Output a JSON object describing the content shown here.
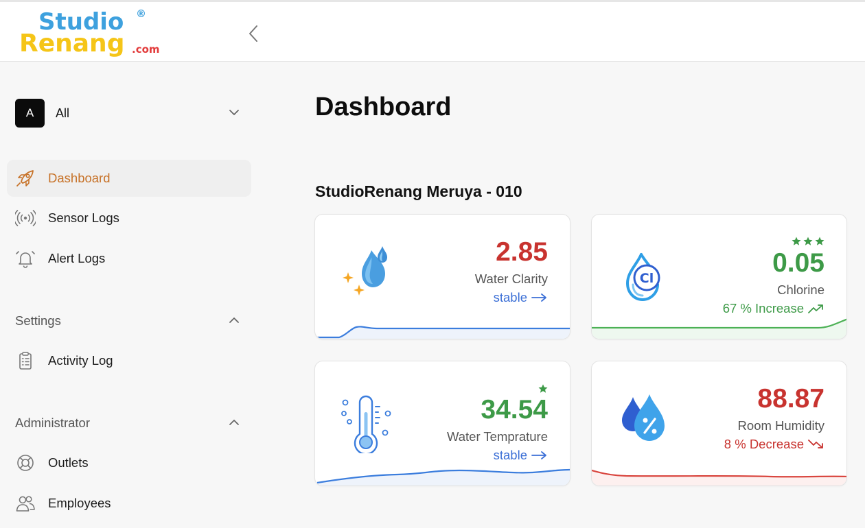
{
  "header": {
    "logo_line1": "Studio",
    "logo_line2": "Renang",
    "logo_suffix": ".com",
    "logo_mark": "®",
    "collapse_icon": "chevron-left-icon"
  },
  "outlet_selector": {
    "avatar": "A",
    "label": "All"
  },
  "nav": {
    "dashboard": "Dashboard",
    "sensor_logs": "Sensor Logs",
    "alert_logs": "Alert Logs",
    "settings": "Settings",
    "activity_log": "Activity Log",
    "administrator": "Administrator",
    "outlets": "Outlets",
    "employees": "Employees"
  },
  "page": {
    "title": "Dashboard",
    "outlet_name": "StudioRenang Meruya - 010"
  },
  "cards": [
    {
      "value": "2.85",
      "label": "Water Clarity",
      "trend": "stable",
      "trend_icon": "arrow-right-icon",
      "value_color": "#c8332f",
      "trend_color": "#3b6fd6",
      "stars": 0
    },
    {
      "value": "0.05",
      "label": "Chlorine",
      "trend": "67 % Increase",
      "trend_icon": "trending-up-icon",
      "value_color": "#3d9a47",
      "trend_color": "#3d9a47",
      "stars": 3
    },
    {
      "value": "34.54",
      "label": "Water Temprature",
      "trend": "stable",
      "trend_icon": "arrow-right-icon",
      "value_color": "#3d9a47",
      "trend_color": "#3b6fd6",
      "stars": 1
    },
    {
      "value": "88.87",
      "label": "Room Humidity",
      "trend": "8 % Decrease",
      "trend_icon": "trending-down-icon",
      "value_color": "#c8332f",
      "trend_color": "#c8332f",
      "stars": 0
    }
  ],
  "colors": {
    "accent": "#c77228",
    "good": "#3d9a47",
    "bad": "#c8332f",
    "info": "#3b6fd6"
  }
}
